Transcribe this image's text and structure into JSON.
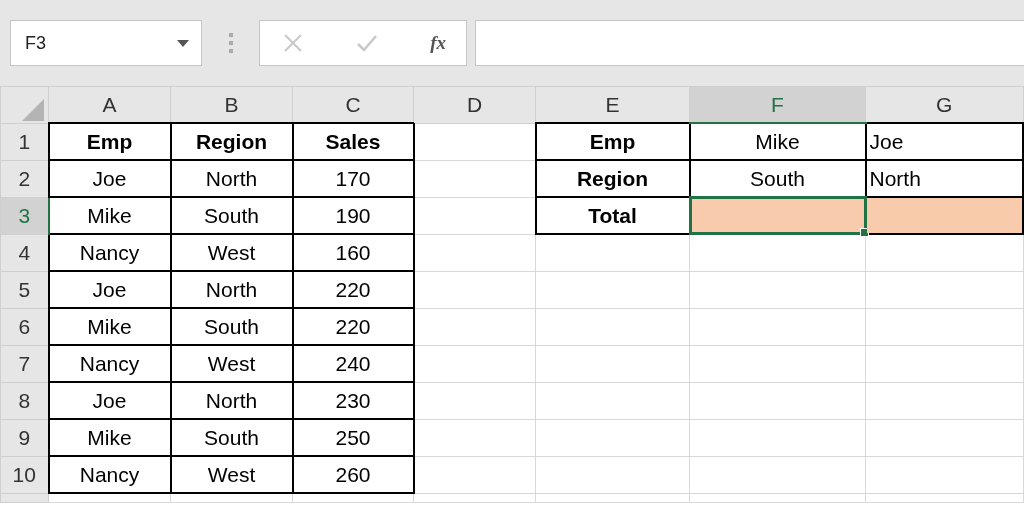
{
  "name_box": {
    "value": "F3"
  },
  "formula_bar": {
    "function_label": "fx"
  },
  "columns": [
    {
      "label": "A",
      "selected": false
    },
    {
      "label": "B",
      "selected": false
    },
    {
      "label": "C",
      "selected": false
    },
    {
      "label": "D",
      "selected": false
    },
    {
      "label": "E",
      "selected": false
    },
    {
      "label": "F",
      "selected": true
    },
    {
      "label": "G",
      "selected": false
    }
  ],
  "rows": [
    {
      "number": "1",
      "selected": false,
      "cells": [
        {
          "text": "Emp",
          "bold": true,
          "centered": true,
          "bordered": true,
          "selected": false
        },
        {
          "text": "Region",
          "bold": true,
          "centered": true,
          "bordered": true,
          "selected": false
        },
        {
          "text": "Sales",
          "bold": true,
          "centered": true,
          "bordered": true,
          "selected": false
        },
        {
          "bordered": false,
          "selected": false
        },
        {
          "text": "Emp",
          "bold": true,
          "centered": true,
          "bordered": true,
          "selected": false
        },
        {
          "text": "Mike",
          "bold": false,
          "centered": true,
          "bordered": true,
          "selected": false
        },
        {
          "text": "Joe",
          "bold": false,
          "centered": false,
          "bordered": true,
          "selected": false
        }
      ]
    },
    {
      "number": "2",
      "selected": false,
      "cells": [
        {
          "text": "Joe",
          "bold": false,
          "centered": true,
          "bordered": true,
          "selected": false
        },
        {
          "text": "North",
          "bold": false,
          "centered": true,
          "bordered": true,
          "selected": false
        },
        {
          "text": "170",
          "bold": false,
          "centered": true,
          "bordered": true,
          "selected": false
        },
        {
          "bordered": false,
          "selected": false
        },
        {
          "text": "Region",
          "bold": true,
          "centered": true,
          "bordered": true,
          "selected": false
        },
        {
          "text": "South",
          "bold": false,
          "centered": true,
          "bordered": true,
          "selected": false
        },
        {
          "text": "North",
          "bold": false,
          "centered": false,
          "bordered": true,
          "selected": false
        }
      ]
    },
    {
      "number": "3",
      "selected": true,
      "cells": [
        {
          "text": "Mike",
          "bold": false,
          "centered": true,
          "bordered": true,
          "selected": false
        },
        {
          "text": "South",
          "bold": false,
          "centered": true,
          "bordered": true,
          "selected": false
        },
        {
          "text": "190",
          "bold": false,
          "centered": true,
          "bordered": true,
          "selected": false
        },
        {
          "bordered": false,
          "selected": false
        },
        {
          "text": "Total",
          "bold": true,
          "centered": true,
          "bordered": true,
          "selected": false
        },
        {
          "bordered": true,
          "selected": true,
          "color": "#f8cbad"
        },
        {
          "bordered": true,
          "selected": false,
          "color": "#f8cbad"
        }
      ]
    },
    {
      "number": "4",
      "selected": false,
      "cells": [
        {
          "text": "Nancy",
          "bold": false,
          "centered": true,
          "bordered": true,
          "selected": false
        },
        {
          "text": "West",
          "bold": false,
          "centered": true,
          "bordered": true,
          "selected": false
        },
        {
          "text": "160",
          "bold": false,
          "centered": true,
          "bordered": true,
          "selected": false
        },
        {
          "bordered": false,
          "selected": false
        },
        {
          "bordered": false,
          "selected": false
        },
        {
          "bordered": false,
          "selected": false
        },
        {
          "bordered": false,
          "selected": false
        }
      ]
    },
    {
      "number": "5",
      "selected": false,
      "cells": [
        {
          "text": "Joe",
          "bold": false,
          "centered": true,
          "bordered": true,
          "selected": false
        },
        {
          "text": "North",
          "bold": false,
          "centered": true,
          "bordered": true,
          "selected": false
        },
        {
          "text": "220",
          "bold": false,
          "centered": true,
          "bordered": true,
          "selected": false
        },
        {
          "bordered": false,
          "selected": false
        },
        {
          "bordered": false,
          "selected": false
        },
        {
          "bordered": false,
          "selected": false
        },
        {
          "bordered": false,
          "selected": false
        }
      ]
    },
    {
      "number": "6",
      "selected": false,
      "cells": [
        {
          "text": "Mike",
          "bold": false,
          "centered": true,
          "bordered": true,
          "selected": false
        },
        {
          "text": "South",
          "bold": false,
          "centered": true,
          "bordered": true,
          "selected": false
        },
        {
          "text": "220",
          "bold": false,
          "centered": true,
          "bordered": true,
          "selected": false
        },
        {
          "bordered": false,
          "selected": false
        },
        {
          "bordered": false,
          "selected": false
        },
        {
          "bordered": false,
          "selected": false
        },
        {
          "bordered": false,
          "selected": false
        }
      ]
    },
    {
      "number": "7",
      "selected": false,
      "cells": [
        {
          "text": "Nancy",
          "bold": false,
          "centered": true,
          "bordered": true,
          "selected": false
        },
        {
          "text": "West",
          "bold": false,
          "centered": true,
          "bordered": true,
          "selected": false
        },
        {
          "text": "240",
          "bold": false,
          "centered": true,
          "bordered": true,
          "selected": false
        },
        {
          "bordered": false,
          "selected": false
        },
        {
          "bordered": false,
          "selected": false
        },
        {
          "bordered": false,
          "selected": false
        },
        {
          "bordered": false,
          "selected": false
        }
      ]
    },
    {
      "number": "8",
      "selected": false,
      "cells": [
        {
          "text": "Joe",
          "bold": false,
          "centered": true,
          "bordered": true,
          "selected": false
        },
        {
          "text": "North",
          "bold": false,
          "centered": true,
          "bordered": true,
          "selected": false
        },
        {
          "text": "230",
          "bold": false,
          "centered": true,
          "bordered": true,
          "selected": false
        },
        {
          "bordered": false,
          "selected": false
        },
        {
          "bordered": false,
          "selected": false
        },
        {
          "bordered": false,
          "selected": false
        },
        {
          "bordered": false,
          "selected": false
        }
      ]
    },
    {
      "number": "9",
      "selected": false,
      "cells": [
        {
          "text": "Mike",
          "bold": false,
          "centered": true,
          "bordered": true,
          "selected": false
        },
        {
          "text": "South",
          "bold": false,
          "centered": true,
          "bordered": true,
          "selected": false
        },
        {
          "text": "250",
          "bold": false,
          "centered": true,
          "bordered": true,
          "selected": false
        },
        {
          "bordered": false,
          "selected": false
        },
        {
          "bordered": false,
          "selected": false
        },
        {
          "bordered": false,
          "selected": false
        },
        {
          "bordered": false,
          "selected": false
        }
      ]
    },
    {
      "number": "10",
      "selected": false,
      "cells": [
        {
          "text": "Nancy",
          "bold": false,
          "centered": true,
          "bordered": true,
          "selected": false
        },
        {
          "text": "West",
          "bold": false,
          "centered": true,
          "bordered": true,
          "selected": false
        },
        {
          "text": "260",
          "bold": false,
          "centered": true,
          "bordered": true,
          "selected": false
        },
        {
          "bordered": false,
          "selected": false
        },
        {
          "bordered": false,
          "selected": false
        },
        {
          "bordered": false,
          "selected": false
        },
        {
          "bordered": false,
          "selected": false
        }
      ]
    }
  ]
}
